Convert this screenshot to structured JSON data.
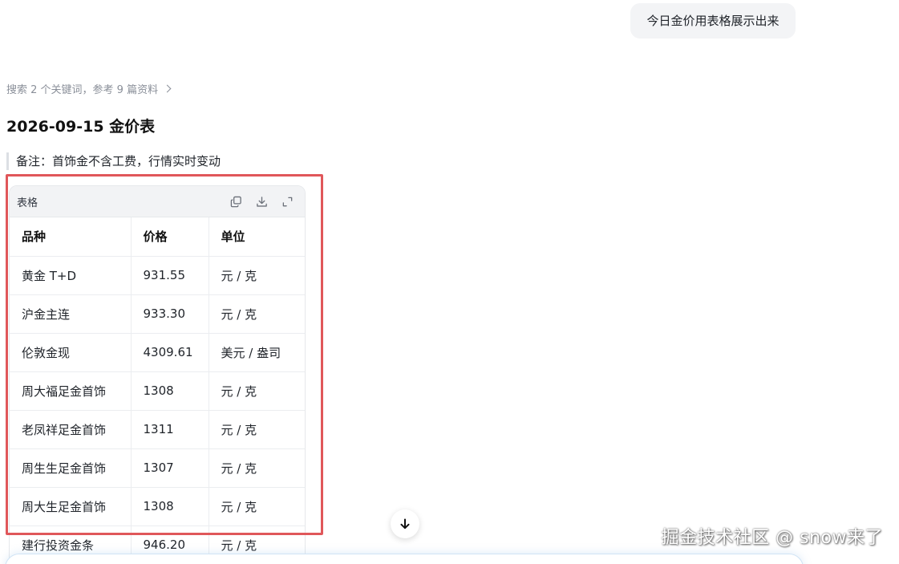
{
  "user_message": "今日金价用表格展示出来",
  "search_summary": "搜索 2 个关键词，参考 9 篇资料",
  "doc_title": "2026-09-15 金价表",
  "note": "备注：首饰金不含工费，行情实时变动",
  "table_card": {
    "title": "表格",
    "icons": [
      "copy-icon",
      "download-icon",
      "expand-icon"
    ],
    "columns": [
      "品种",
      "价格",
      "单位"
    ],
    "rows": [
      [
        "黄金 T+D",
        "931.55",
        "元 / 克"
      ],
      [
        "沪金主连",
        "933.30",
        "元 / 克"
      ],
      [
        "伦敦金现",
        "4309.61",
        "美元 / 盎司"
      ],
      [
        "周大福足金首饰",
        "1308",
        "元 / 克"
      ],
      [
        "老凤祥足金首饰",
        "1311",
        "元 / 克"
      ],
      [
        "周生生足金首饰",
        "1307",
        "元 / 克"
      ],
      [
        "周大生足金首饰",
        "1308",
        "元 / 克"
      ],
      [
        "建行投资金条",
        "946.20",
        "元 / 克"
      ]
    ]
  },
  "watermark": "掘金技术社区 @ snow来了",
  "colors": {
    "highlight_border": "#e0575a",
    "bubble_bg": "#f3f4f6",
    "card_header_bg": "#f2f3f5"
  }
}
